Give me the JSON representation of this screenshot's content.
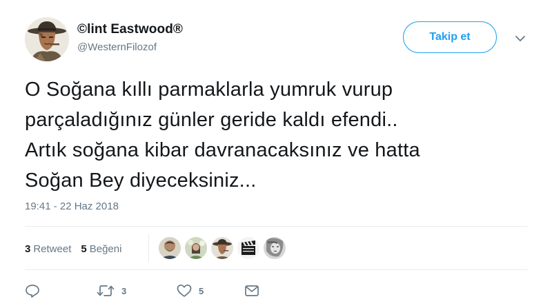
{
  "author": {
    "display_name": "©lint Eastwood®",
    "handle": "@WesternFilozof"
  },
  "follow_button": {
    "label": "Takip et"
  },
  "tweet": {
    "text": "O Soğana kıllı parmaklarla yumruk vurup\nparçaladığınız günler geride kaldı efendi..\nArtık soğana kibar davranacaksınız ve hatta\nSoğan Bey diyeceksiniz...",
    "timestamp": "19:41 - 22 Haz 2018"
  },
  "stats": {
    "retweets": {
      "count": "3",
      "label": "Retweet"
    },
    "likes": {
      "count": "5",
      "label": "Beğeni"
    }
  },
  "likers": [
    {
      "icon": "bearded-man-avatar"
    },
    {
      "icon": "woman-flowers-avatar"
    },
    {
      "icon": "cowboy-avatar"
    },
    {
      "icon": "clapperboard-avatar"
    },
    {
      "icon": "sketch-face-avatar"
    }
  ],
  "actions": {
    "reply": {
      "icon": "reply-icon",
      "count": ""
    },
    "retweet": {
      "icon": "retweet-icon",
      "count": "3"
    },
    "like": {
      "icon": "heart-icon",
      "count": "5"
    },
    "message": {
      "icon": "envelope-icon",
      "count": ""
    }
  },
  "colors": {
    "accent": "#1da1f2",
    "secondary_text": "#657786",
    "primary_text": "#14171a",
    "divider": "#e6ecf0"
  }
}
